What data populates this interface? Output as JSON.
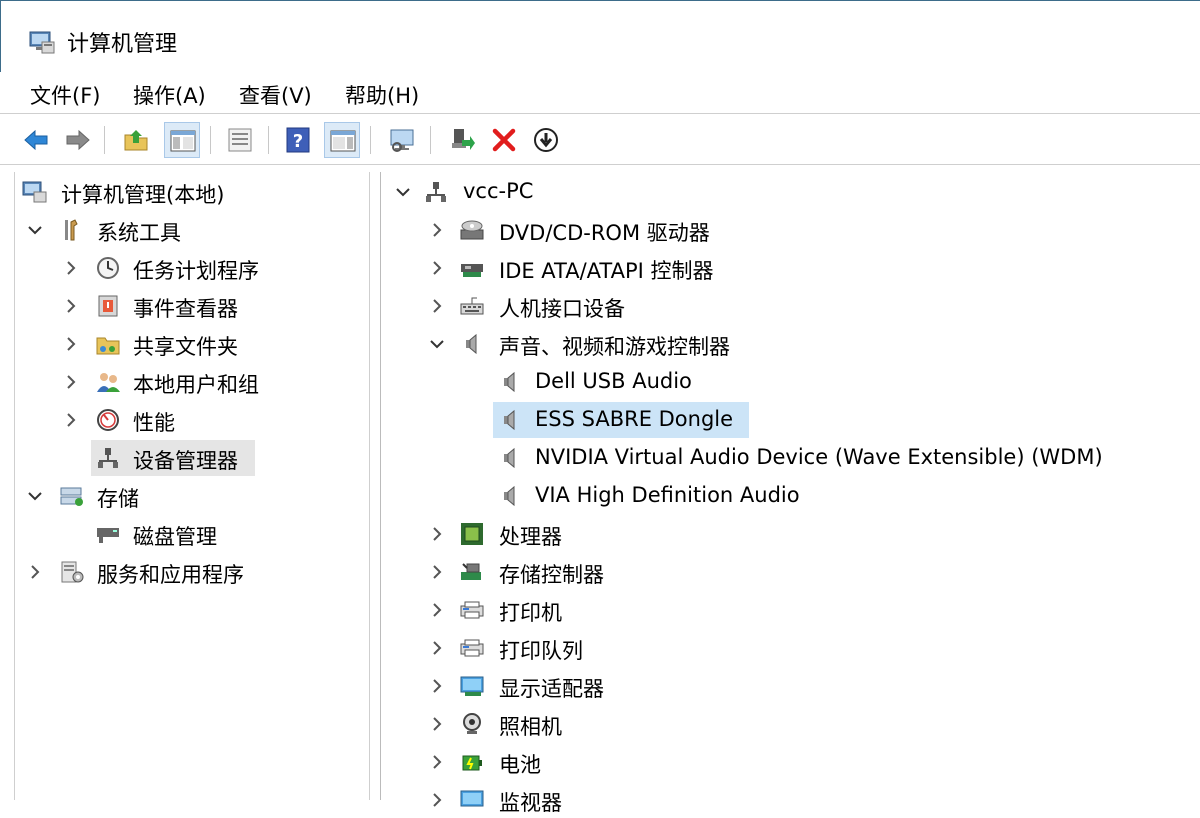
{
  "window": {
    "title": "计算机管理"
  },
  "menu": [
    "文件(F)",
    "操作(A)",
    "查看(V)",
    "帮助(H)"
  ],
  "toolbar": {
    "buttons": [
      "back-icon",
      "forward-icon",
      "up-folder-icon",
      "show-hide-tree-icon",
      "properties-icon",
      "help-icon",
      "show-action-pane-icon",
      "monitor-icon",
      "update-driver-icon",
      "uninstall-icon",
      "disable-device-icon"
    ]
  },
  "left_tree": {
    "root": "计算机管理(本地)",
    "system_tools": "系统工具",
    "task_scheduler": "任务计划程序",
    "event_viewer": "事件查看器",
    "shared_folders": "共享文件夹",
    "local_users": "本地用户和组",
    "performance": "性能",
    "device_manager": "设备管理器",
    "storage": "存储",
    "disk_management": "磁盘管理",
    "services_apps": "服务和应用程序"
  },
  "right_tree": {
    "computer": "vcc-PC",
    "dvd": "DVD/CD-ROM 驱动器",
    "ide": "IDE ATA/ATAPI 控制器",
    "hid": "人机接口设备",
    "sound": "声音、视频和游戏控制器",
    "dell_usb": "Dell USB Audio",
    "ess_sabre": "ESS SABRE Dongle",
    "nvidia_audio": "NVIDIA Virtual Audio Device (Wave Extensible) (WDM)",
    "via_audio": "VIA High Definition Audio",
    "processor": "处理器",
    "storage_ctrl": "存储控制器",
    "printer": "打印机",
    "print_queue": "打印队列",
    "display": "显示适配器",
    "camera": "照相机",
    "battery": "电池",
    "monitor": "监视器"
  },
  "colors": {
    "selection_blue": "#cce4f7",
    "selection_gray": "#e5e5e5",
    "delete_red": "#e11d1d",
    "back_blue": "#2e86d6"
  }
}
